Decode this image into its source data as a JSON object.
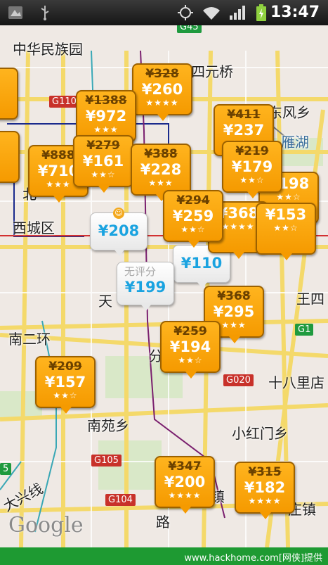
{
  "status_bar": {
    "time": "13:47",
    "icons": [
      "image-notification-icon",
      "usb-icon",
      "gps-icon",
      "wifi-icon",
      "signal-icon",
      "battery-charging-icon"
    ]
  },
  "map": {
    "places": [
      {
        "id": "minzuyuan",
        "text": "中华民族园"
      },
      {
        "id": "siyuanqiao",
        "text": "四元桥"
      },
      {
        "id": "dongfengxiang",
        "text": "东风乡"
      },
      {
        "id": "ciqu",
        "text": "雁湖"
      },
      {
        "id": "xicheng",
        "text": "西城区"
      },
      {
        "id": "wangsi",
        "text": "王四"
      },
      {
        "id": "nanerhuan",
        "text": "南二环"
      },
      {
        "id": "tian",
        "text": "天"
      },
      {
        "id": "fen",
        "text": "分"
      },
      {
        "id": "shibali",
        "text": "十八里店"
      },
      {
        "id": "nanyuan",
        "text": "南苑乡"
      },
      {
        "id": "xiaohongmen",
        "text": "小红门乡"
      },
      {
        "id": "daxing",
        "text": "大兴线"
      },
      {
        "id": "zhen",
        "text": "镇"
      },
      {
        "id": "lu",
        "text": "路"
      },
      {
        "id": "yizhuang",
        "text": "庄镇"
      },
      {
        "id": "bei",
        "text": "北"
      }
    ],
    "shields": [
      {
        "id": "g110",
        "text": "G110",
        "color": "red"
      },
      {
        "id": "g45",
        "text": "G45",
        "color": "green"
      },
      {
        "id": "g1",
        "text": "G1",
        "color": "green"
      },
      {
        "id": "g020",
        "text": "G020",
        "color": "red"
      },
      {
        "id": "g105",
        "text": "G105",
        "color": "red"
      },
      {
        "id": "g104",
        "text": "G104",
        "color": "red"
      },
      {
        "id": "g5",
        "text": "5",
        "color": "green"
      }
    ],
    "google_logo": "Google"
  },
  "hotels": [
    {
      "old": "¥328",
      "price": "¥260",
      "stars": "★★★★"
    },
    {
      "old": "¥1388",
      "price": "¥972",
      "stars": "★★★"
    },
    {
      "old": "¥411",
      "price": "¥237",
      "stars": "★★★"
    },
    {
      "old": "¥888",
      "price": "¥710",
      "stars": "★★★"
    },
    {
      "old": "¥279",
      "price": "¥161",
      "stars": "★★☆"
    },
    {
      "old": "¥388",
      "price": "¥228",
      "stars": "★★★"
    },
    {
      "old": "¥219",
      "price": "¥179",
      "stars": "★★☆"
    },
    {
      "old": "¥294",
      "price": "¥259",
      "stars": "★★☆"
    },
    {
      "old": "",
      "price": "¥198",
      "stars": "★★☆"
    },
    {
      "old": "",
      "price": "¥368",
      "stars": "★★★★"
    },
    {
      "old": "",
      "price": "¥153",
      "stars": "★★☆"
    },
    {
      "old": "¥368",
      "price": "¥295",
      "stars": "★★★"
    },
    {
      "old": "¥259",
      "price": "¥194",
      "stars": "★★☆"
    },
    {
      "old": "¥209",
      "price": "¥157",
      "stars": "★★☆"
    },
    {
      "old": "¥347",
      "price": "¥200",
      "stars": "★★★★"
    },
    {
      "old": "¥315",
      "price": "¥182",
      "stars": "★★★★"
    }
  ],
  "white_markers": [
    {
      "price": "¥208"
    },
    {
      "price": "¥199",
      "label": "无评分"
    },
    {
      "price": "¥110"
    }
  ],
  "footer": {
    "watermark": "www.hackhome.com[网侠]提供"
  }
}
